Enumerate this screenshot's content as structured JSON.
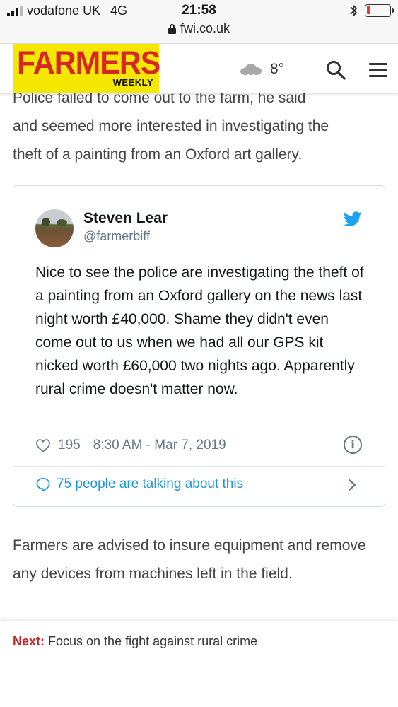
{
  "status_bar": {
    "carrier": "vodafone UK",
    "network": "4G",
    "time": "21:58",
    "url": "fwi.co.uk",
    "battery_level": 0.08,
    "battery_color": "#e53935"
  },
  "header": {
    "logo_main": "FARMERS",
    "logo_sub": "WEEKLY",
    "logo_bg": "#f6e700",
    "logo_color": "#d7262a",
    "weather_icon": "cloud-icon",
    "temperature": "8°",
    "search_icon": "search-icon",
    "menu_icon": "hamburger-menu-icon"
  },
  "article": {
    "partial_line": "Police failed to come out to the farm, he said",
    "para_top_lines": [
      "and seemed more interested in investigating the",
      "theft of a painting from an Oxford art gallery."
    ],
    "para_bottom": "Farmers are advised to insure equipment and remove any devices from machines left in the field."
  },
  "tweet": {
    "name": "Steven Lear",
    "handle": "@farmerbiff",
    "text": "Nice to see the police are investigating the theft of a painting from an Oxford gallery on the news last night worth £40,000. Shame they didn't even come out to us when we had all our GPS kit nicked worth £60,000 two nights ago. Apparently rural crime doesn't matter now.",
    "likes": "195",
    "timestamp": "8:30 AM - Mar 7, 2019",
    "talking": "75 people are talking about this",
    "accent": "#1da1f2"
  },
  "next": {
    "label": "Next:",
    "title": "Focus on the fight against rural crime"
  }
}
